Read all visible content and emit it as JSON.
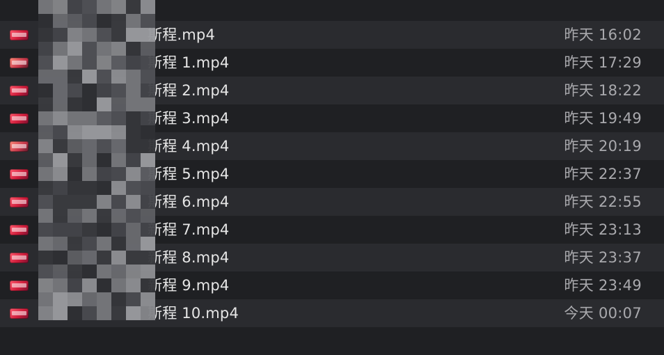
{
  "files": [
    {
      "name": "",
      "date": ""
    },
    {
      "prefix": "",
      "name": "斯程.mp4",
      "date": "昨天 16:02"
    },
    {
      "prefix": "",
      "name": "斯程 1.mp4",
      "date": "昨天 17:29"
    },
    {
      "prefix": "",
      "name": "斯程 2.mp4",
      "date": "昨天 18:22"
    },
    {
      "prefix": "",
      "name": "斯程 3.mp4",
      "date": "昨天 19:49"
    },
    {
      "prefix": "",
      "name": "斯程 4.mp4",
      "date": "昨天 20:19"
    },
    {
      "prefix": "",
      "name": "斯程 5.mp4",
      "date": "昨天 22:37"
    },
    {
      "prefix": "",
      "name": "斯程 6.mp4",
      "date": "昨天 22:55"
    },
    {
      "prefix": "",
      "name": "新程 7.mp4",
      "date": "昨天 23:13"
    },
    {
      "prefix": "",
      "name": "新程 8.mp4",
      "date": "昨天 23:37"
    },
    {
      "prefix": "",
      "name": "新程 9.mp4",
      "date": "昨天 23:49"
    },
    {
      "prefix": "",
      "name": "斯程 10.mp4",
      "date": "今天 00:07"
    },
    {
      "name": "",
      "date": ""
    }
  ],
  "colors": {
    "row_odd": "#2a2b2f",
    "row_even": "#1f2023",
    "name_text": "#e6e6e6",
    "date_text": "#a9a9ad",
    "thumb_accent": "#d11e3c"
  },
  "icons": {
    "file_thumbnail": "video-thumbnail-icon"
  }
}
